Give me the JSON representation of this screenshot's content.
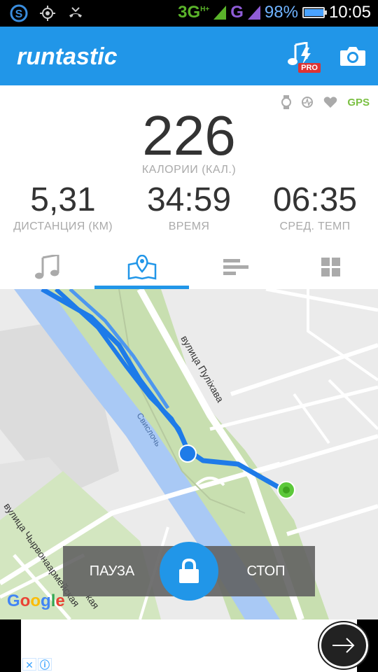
{
  "status_bar": {
    "network_1": "3G",
    "network_1_sup": "H+",
    "network_2": "G",
    "battery": "98%",
    "battery_level": 0.98,
    "time": "10:05"
  },
  "app_bar": {
    "logo": "runtastic",
    "pro_badge": "PRO",
    "brand_color": "#2196e8"
  },
  "sensors": {
    "gps_label": "GPS",
    "gps_color": "#7bc043"
  },
  "stats": {
    "calories": {
      "value": "226",
      "label": "КАЛОРИИ (КАЛ.)"
    },
    "distance": {
      "value": "5,31",
      "label": "ДИСТАНЦИЯ (КМ)"
    },
    "time": {
      "value": "34:59",
      "label": "ВРЕМЯ"
    },
    "pace": {
      "value": "06:35",
      "label": "СРЕД. ТЕМП"
    }
  },
  "tabs": [
    "music-tab",
    "map-tab",
    "splits-tab",
    "dashboard-tab"
  ],
  "active_tab": 1,
  "map": {
    "street_1": "вулица Пуліхава",
    "street_2": "вулица Чырвонаармейская",
    "street_2_tail": "кая",
    "river": "Свислочь",
    "attribution": "Google"
  },
  "controls": {
    "pause": "ПАУЗА",
    "stop": "СТОП"
  }
}
